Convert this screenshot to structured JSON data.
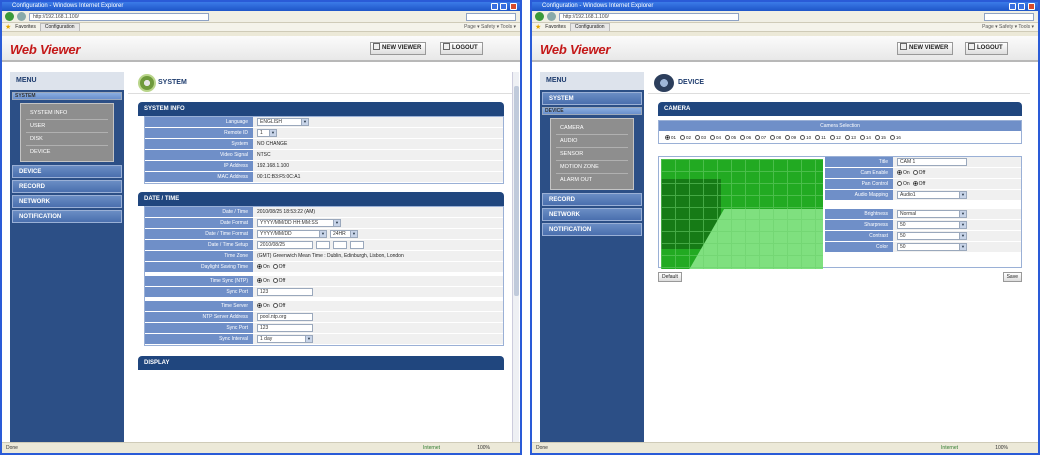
{
  "left": {
    "window": {
      "title": "Configuration - Windows Internet Explorer",
      "address": "http://192.168.1.100/"
    },
    "favorites": {
      "label": "Favorites",
      "tab": "Configuration",
      "commands": "Page ▾  Safety ▾  Tools ▾"
    },
    "header": {
      "logo": "Web Viewer",
      "new_viewer": "NEW VIEWER",
      "logout": "LOGOUT"
    },
    "menu": {
      "title": "MENU",
      "system": "SYSTEM",
      "submenu": [
        "SYSTEM INFO",
        "USER",
        "DISK",
        "DEVICE"
      ],
      "items": [
        "DEVICE",
        "RECORD",
        "NETWORK",
        "NOTIFICATION"
      ]
    },
    "page_title": "SYSTEM",
    "sections": {
      "system_info": {
        "title": "SYSTEM INFO",
        "rows": [
          {
            "label": "Language",
            "value": "ENGLISH"
          },
          {
            "label": "Remote ID",
            "value": "1"
          },
          {
            "label": "System",
            "value": "NO CHANGE"
          },
          {
            "label": "Video Signal",
            "value": "NTSC"
          },
          {
            "label": "IP Address",
            "value": "192.168.1.100"
          },
          {
            "label": "MAC Address",
            "value": "00:1C:B3:F5:0C:A1"
          }
        ]
      },
      "date_time": {
        "title": "DATE / TIME",
        "rows": [
          {
            "label": "Date / Time",
            "value": "2010/08/25 18:53:22 (AM)"
          },
          {
            "label": "Date Format",
            "value": "YYYY/MM/DD HH:MM:SS"
          },
          {
            "label": "Date / Time Format",
            "value": "YYYY/MM/DD",
            "extra": "24HR"
          },
          {
            "label": "Date / Time Setup",
            "value": "2010/08/25"
          },
          {
            "label": "Time Zone",
            "value": "(GMT) Greenwich Mean Time : Dublin, Edinburgh, Lisbon, London"
          },
          {
            "label": "Daylight Saving Time",
            "on": "On",
            "off": "Off"
          },
          {
            "label": "Time Sync (NTP)",
            "on": "On",
            "off": "Off"
          },
          {
            "label": "Sync Port",
            "value": "123"
          },
          {
            "label": "Time Server",
            "on": "On",
            "off": "Off"
          },
          {
            "label": "NTP Server Address",
            "value": "pool.ntp.org"
          },
          {
            "label": "Sync Port",
            "value": "123"
          },
          {
            "label": "Sync Interval",
            "value": "1 day"
          }
        ]
      },
      "display": {
        "title": "DISPLAY"
      }
    },
    "status": {
      "text": "Done",
      "zone": "Internet",
      "zoom": "100%"
    }
  },
  "right": {
    "window": {
      "title": "Configuration - Windows Internet Explorer",
      "address": "http://192.168.1.100/"
    },
    "favorites": {
      "label": "Favorites",
      "tab": "Configuration",
      "commands": "Page ▾  Safety ▾  Tools ▾"
    },
    "header": {
      "logo": "Web Viewer",
      "new_viewer": "NEW VIEWER",
      "logout": "LOGOUT"
    },
    "menu": {
      "title": "MENU",
      "system": "SYSTEM",
      "device": "DEVICE",
      "submenu": [
        "CAMERA",
        "AUDIO",
        "SENSOR",
        "MOTION ZONE",
        "ALARM OUT"
      ],
      "items": [
        "RECORD",
        "NETWORK",
        "NOTIFICATION"
      ]
    },
    "page_title": "DEVICE",
    "camera": {
      "title": "CAMERA",
      "selection_title": "Camera Selection",
      "channels": [
        "01",
        "02",
        "03",
        "04",
        "05",
        "06",
        "07",
        "08",
        "09",
        "10",
        "11",
        "12",
        "13",
        "14",
        "15",
        "16"
      ],
      "rows": [
        {
          "label": "Title",
          "value": "CAM 1"
        },
        {
          "label": "Cam Enable",
          "on": "On",
          "off": "Off"
        },
        {
          "label": "Pan Control",
          "on": "On",
          "off": "Off"
        },
        {
          "label": "Audio Mapping",
          "value": "Audio1"
        },
        {
          "label": "Brightness",
          "value": "Normal"
        },
        {
          "label": "Sharpness",
          "value": "50"
        },
        {
          "label": "Contrast",
          "value": "50"
        },
        {
          "label": "Color",
          "value": "50"
        }
      ],
      "default_btn": "Default",
      "save_btn": "Save"
    },
    "status": {
      "text": "Done",
      "zone": "Internet",
      "zoom": "100%"
    }
  }
}
